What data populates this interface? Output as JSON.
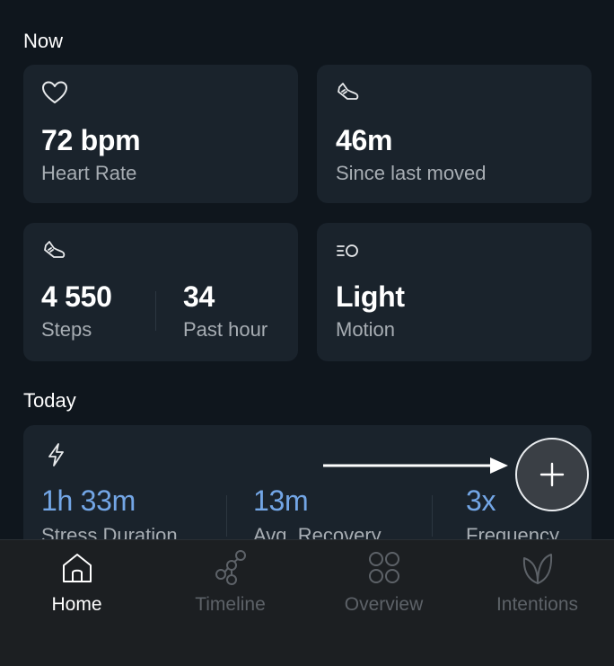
{
  "now": {
    "title": "Now",
    "heart": {
      "value": "72 bpm",
      "label": "Heart Rate",
      "icon": "heart-icon"
    },
    "moved": {
      "value": "46m",
      "label": "Since last moved",
      "icon": "shoe-icon"
    },
    "steps": {
      "value": "4 550",
      "label": "Steps",
      "hour_value": "34",
      "hour_label": "Past hour",
      "icon": "shoe-icon"
    },
    "motion": {
      "value": "Light",
      "label": "Motion",
      "icon": "motion-icon"
    }
  },
  "today": {
    "title": "Today",
    "icon": "lightning-icon",
    "stress_duration": {
      "value": "1h 33m",
      "label": "Stress Duration"
    },
    "avg_recovery": {
      "value": "13m",
      "label": "Avg. Recovery"
    },
    "frequency": {
      "value": "3x",
      "label": "Frequency"
    }
  },
  "fab": {
    "icon": "plus-icon"
  },
  "tabs": [
    {
      "label": "Home",
      "icon": "home-icon",
      "active": true
    },
    {
      "label": "Timeline",
      "icon": "timeline-icon",
      "active": false
    },
    {
      "label": "Overview",
      "icon": "overview-icon",
      "active": false
    },
    {
      "label": "Intentions",
      "icon": "intentions-icon",
      "active": false
    }
  ],
  "colors": {
    "background": "#0f161d",
    "card": "#1a232c",
    "accent": "#73a6e6",
    "tabbar": "#1c1f22"
  }
}
